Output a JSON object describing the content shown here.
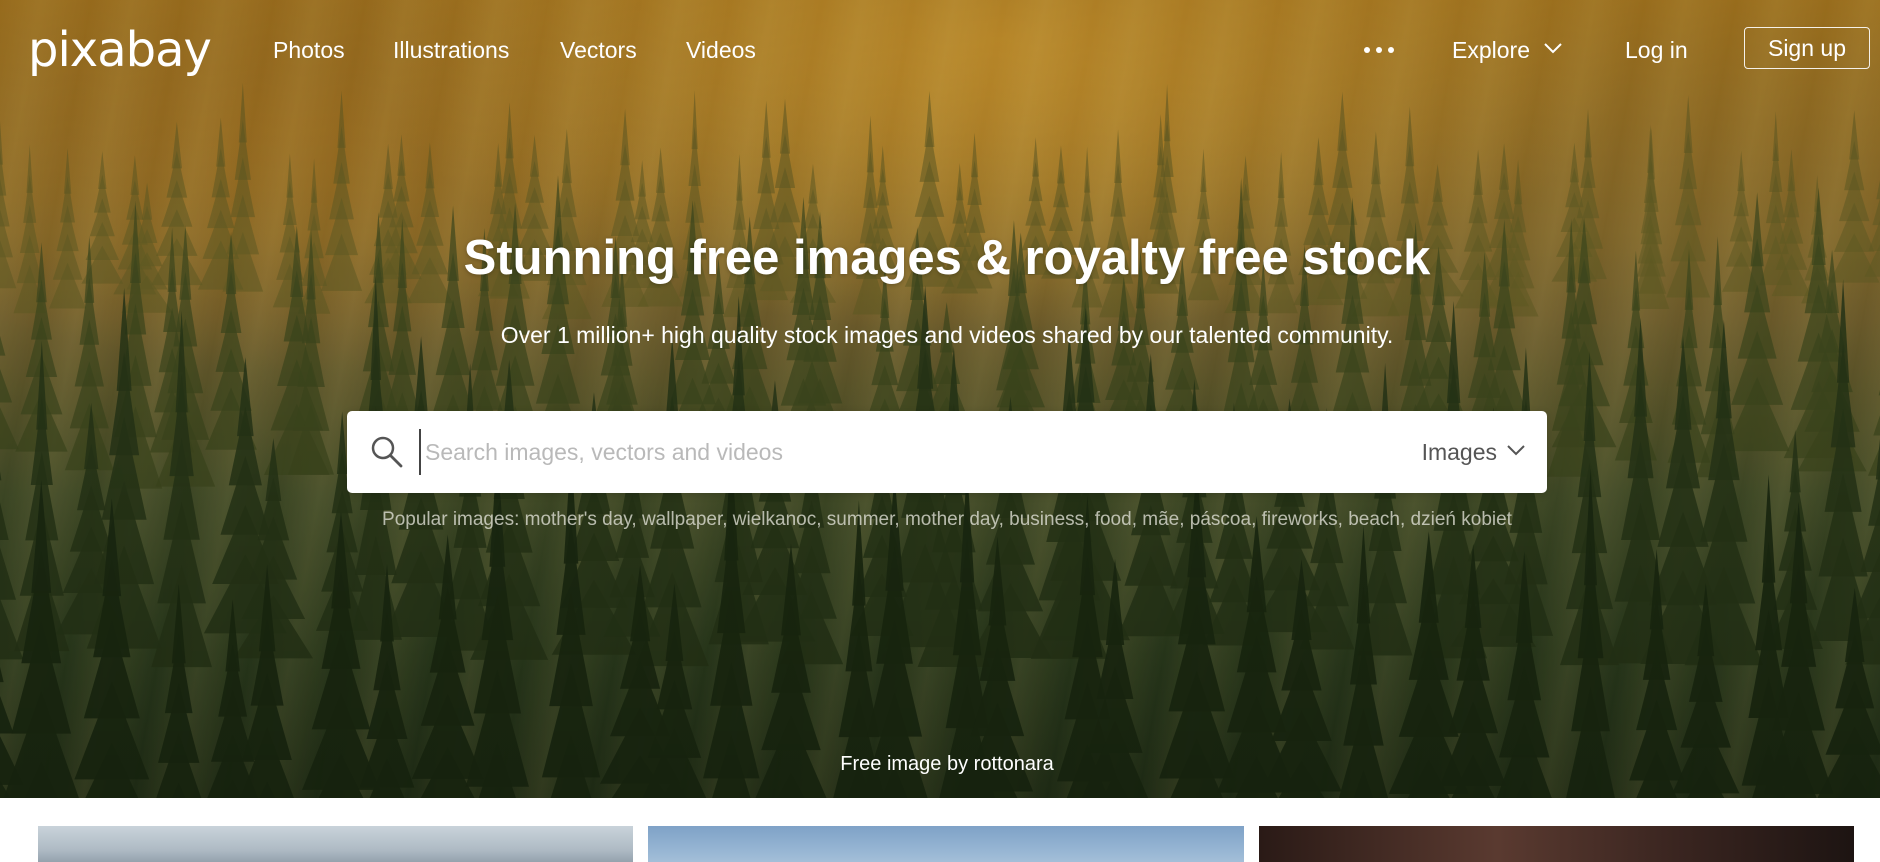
{
  "brand": {
    "logo_text": "pixabay"
  },
  "nav": {
    "links": [
      "Photos",
      "Illustrations",
      "Vectors",
      "Videos"
    ],
    "more_icon": "more-horizontal-icon",
    "explore_label": "Explore",
    "login_label": "Log in",
    "signup_label": "Sign up"
  },
  "hero": {
    "title": "Stunning free images & royalty free stock",
    "subtitle": "Over 1 million+ high quality stock images and videos shared by our talented community.",
    "credit_prefix": "Free image by",
    "credit_author": "rottonara"
  },
  "search": {
    "placeholder": "Search images, vectors and videos",
    "value": "",
    "type_selected": "Images",
    "icon": "search-icon"
  },
  "popular": {
    "label": "Popular images:",
    "terms": [
      "mother's day",
      "wallpaper",
      "wielkanoc",
      "summer",
      "mother day",
      "business",
      "food",
      "mãe",
      "páscoa",
      "fireworks",
      "beach",
      "dzień kobiet"
    ]
  },
  "colors": {
    "text_on_hero": "#ffffff",
    "search_bg": "#ffffff",
    "placeholder": "#b9b9b9"
  }
}
